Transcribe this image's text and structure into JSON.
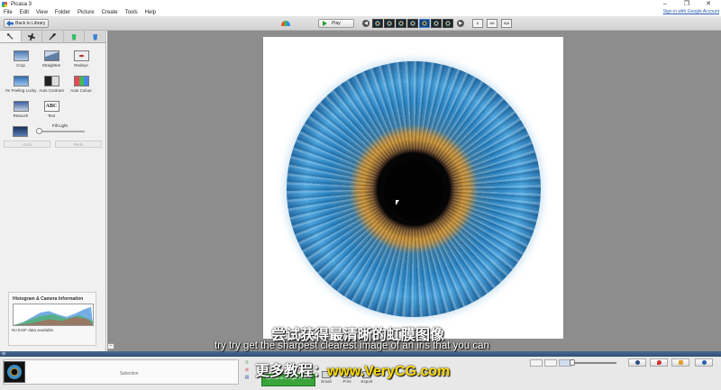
{
  "window": {
    "title": "Picasa 3",
    "controls": [
      "–",
      "❐",
      "✕"
    ]
  },
  "menu": {
    "items": [
      "File",
      "Edit",
      "View",
      "Folder",
      "Picture",
      "Create",
      "Tools",
      "Help"
    ],
    "signin": "Sign in with Google Account"
  },
  "toolbar": {
    "back_label": "Back to Library",
    "play_label": "Play",
    "view_modes": [
      "A",
      "AA",
      "A|A"
    ]
  },
  "edit_tabs": [
    "basic-fixes",
    "tuning",
    "effects",
    "effects-2",
    "effects-3"
  ],
  "basic_fixes": {
    "tools": [
      "Crop",
      "Straighten",
      "Redeye",
      "I'm Feeling Lucky",
      "Auto Contrast",
      "Auto Colour",
      "Retouch",
      "Text"
    ],
    "text_icon": "ABC",
    "fill_light_label": "Fill Light",
    "fill_light_value": 0,
    "undo_label": "Undo",
    "redo_label": "Redo"
  },
  "histogram": {
    "title": "Histogram & Camera Information",
    "no_exif": "No EXIF data available."
  },
  "tray": {
    "selection_label": "Selection",
    "upload_label": "Upload to Google Photos",
    "actions": [
      "Email",
      "Print",
      "Export"
    ],
    "zoom_level": 0.05
  },
  "subtitles": {
    "line1": "尝试获得最清晰的虹膜图像",
    "line2": "try try get the sharpest clearest image of an iris that you can",
    "line3_prefix": "更多教程：",
    "line3_url": "www.VeryCG.com"
  },
  "colors": {
    "tray_bar": "#2f4e76",
    "upload_green": "#3aa43a",
    "canvas_bg": "#8d8d8d"
  }
}
